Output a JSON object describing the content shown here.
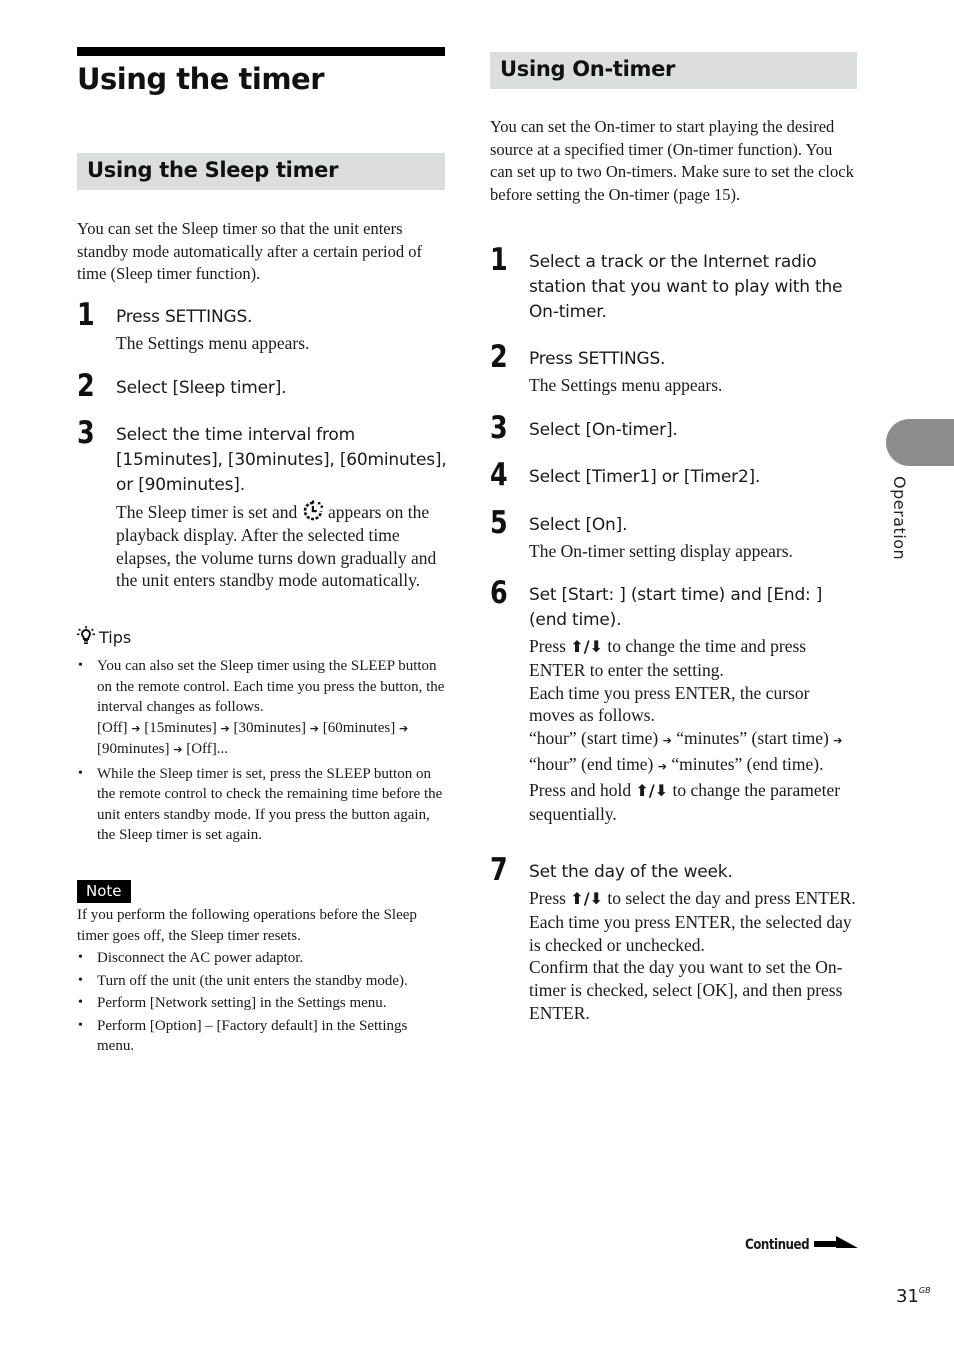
{
  "page": {
    "title": "Using the timer",
    "side_tab_label": "Operation",
    "continued_label": "Continued",
    "page_number": "31",
    "page_suffix": "GB"
  },
  "sleep_timer": {
    "heading": "Using the Sleep timer",
    "intro": "You can set the Sleep timer so that the unit enters standby mode automatically after a certain period of time (Sleep timer function).",
    "steps": [
      {
        "num": "1",
        "head": "Press SETTINGS.",
        "body": "The Settings menu appears."
      },
      {
        "num": "2",
        "head": "Select [Sleep timer].",
        "body": ""
      },
      {
        "num": "3",
        "head": "Select the time interval from [15minutes], [30minutes], [60minutes], or [90minutes].",
        "body_before_icon": "The Sleep timer is set and",
        "body_after_icon": "appears on the playback display. After the selected time elapses, the volume turns down gradually and the unit enters standby mode automatically.",
        "icon": "sleep-timer-icon"
      }
    ],
    "tips": {
      "label": "Tips",
      "icon": "lightbulb-icon",
      "items": [
        {
          "text": "You can also set the Sleep timer using the SLEEP button on the remote control. Each time you press the button, the interval changes as follows.",
          "sequence": [
            "[Off]",
            "[15minutes]",
            "[30minutes]",
            "[60minutes]",
            "[90minutes]",
            "[Off]..."
          ]
        },
        {
          "text": "While the Sleep timer is set, press the SLEEP button on the remote control to check the remaining time before the unit enters standby mode. If you press the button again, the Sleep timer is set again."
        }
      ]
    },
    "note": {
      "label": "Note",
      "intro": "If you perform the following operations before the Sleep timer goes off, the Sleep timer resets.",
      "items": [
        "Disconnect the AC power adaptor.",
        "Turn off the unit (the unit enters the standby mode).",
        "Perform [Network setting] in the Settings menu.",
        "Perform [Option] – [Factory default] in the Settings menu."
      ]
    }
  },
  "on_timer": {
    "heading": "Using On-timer",
    "intro": "You can set the On-timer to start playing the desired source at a specified timer (On-timer function). You can set up to two On-timers. Make sure to set the clock before setting the On-timer (page 15).",
    "steps": [
      {
        "num": "1",
        "head": "Select a track or the Internet radio station that you want to play with the On-timer."
      },
      {
        "num": "2",
        "head": "Press SETTINGS.",
        "body": "The Settings menu appears."
      },
      {
        "num": "3",
        "head": "Select [On-timer]."
      },
      {
        "num": "4",
        "head": "Select [Timer1] or [Timer2]."
      },
      {
        "num": "5",
        "head": "Select [On].",
        "body": "The On-timer setting display appears."
      },
      {
        "num": "6",
        "head": "Set [Start: ] (start time) and [End: ] (end time).",
        "press_pre": "Press",
        "press_post": "to change the time and press ENTER to enter the setting.",
        "cursor_text": "Each time you press ENTER, the cursor moves as follows.",
        "cursor_seq": [
          "“hour” (start time)",
          "“minutes” (start time)",
          "“hour” (end time)",
          "“minutes” (end time)."
        ],
        "hold_pre": "Press and hold",
        "hold_post": "to change the parameter sequentially."
      },
      {
        "num": "7",
        "head": "Set the day of the week.",
        "press_pre": "Press",
        "press_post": "to select the day and press ENTER.",
        "body2": "Each time you press ENTER, the selected day is checked or unchecked.",
        "body3": "Confirm that the day you want to set the On-timer is checked, select [OK], and then press ENTER."
      }
    ]
  },
  "symbols": {
    "up_down": "🡅/🡇",
    "arrow": "→"
  }
}
